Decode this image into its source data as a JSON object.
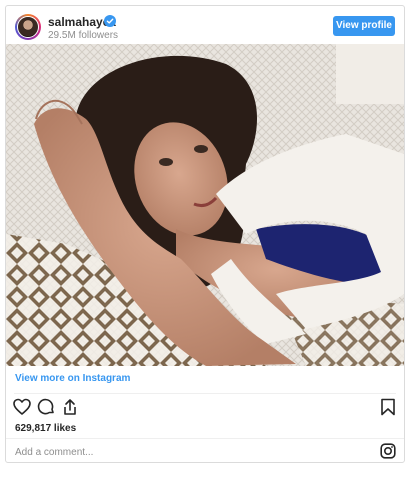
{
  "header": {
    "username": "salmahayek",
    "followers": "29.5M followers",
    "view_profile_label": "View profile",
    "verified_color": "#3897f0"
  },
  "post": {
    "view_more_label": "View more on Instagram",
    "likes": "629,817 likes",
    "comment_placeholder": "Add a comment..."
  },
  "icons": {
    "avatar": "avatar",
    "verified": "verified-badge-icon",
    "like": "heart-icon",
    "comment": "comment-icon",
    "share": "share-icon",
    "save": "bookmark-icon",
    "brand": "instagram-icon"
  },
  "colors": {
    "accent": "#3897f0",
    "border": "#dbdbdb",
    "muted": "#8e8e8e"
  }
}
